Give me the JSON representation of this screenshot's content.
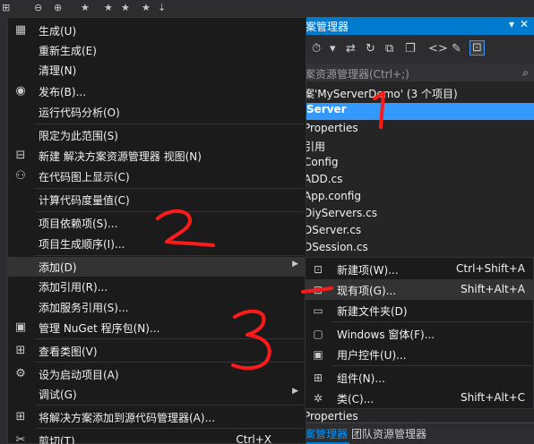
{
  "background": {
    "solution_explorer": {
      "title": "案管理器",
      "search_placeholder": "案资源管理器(Ctrl+;)",
      "tree": [
        "案'MyServerDemo' (3 个项目)",
        "Server",
        "Properties",
        "引用",
        "Config",
        "ADD.cs",
        "App.config",
        "DiyServers.cs",
        "DServer.cs",
        "DSession.cs",
        "Properties"
      ],
      "tabs": [
        "案管理器",
        "团队资源管理器"
      ]
    }
  },
  "context_menu": {
    "items": [
      {
        "label": "生成(U)",
        "icon": "build-icon"
      },
      {
        "label": "重新生成(E)",
        "icon": ""
      },
      {
        "label": "清理(N)",
        "icon": ""
      },
      {
        "label": "发布(B)...",
        "icon": "globe-icon"
      },
      {
        "label": "运行代码分析(O)",
        "icon": ""
      },
      {
        "label": "限定为此范围(S)",
        "icon": ""
      },
      {
        "label": "新建 解决方案资源管理器 视图(N)",
        "icon": "new-view-icon"
      },
      {
        "label": "在代码图上显示(C)",
        "icon": "code-map-icon"
      },
      {
        "label": "计算代码度量值(C)",
        "icon": ""
      },
      {
        "label": "项目依赖项(S)...",
        "icon": ""
      },
      {
        "label": "项目生成顺序(I)...",
        "icon": ""
      },
      {
        "label": "添加(D)",
        "icon": "",
        "has_submenu": true
      },
      {
        "label": "添加引用(R)...",
        "icon": ""
      },
      {
        "label": "添加服务引用(S)...",
        "icon": ""
      },
      {
        "label": "管理 NuGet 程序包(N)...",
        "icon": "nuget-icon"
      },
      {
        "label": "查看类图(V)",
        "icon": "class-diagram-icon"
      },
      {
        "label": "设为启动项目(A)",
        "icon": "gear-icon"
      },
      {
        "label": "调试(G)",
        "icon": "",
        "has_submenu": true
      },
      {
        "label": "将解决方案添加到源代码管理器(A)...",
        "icon": "source-control-icon"
      },
      {
        "label": "剪切(T)",
        "icon": "scissors-icon",
        "shortcut": "Ctrl+X"
      }
    ]
  },
  "submenu": {
    "items": [
      {
        "label": "新建项(W)...",
        "shortcut": "Ctrl+Shift+A",
        "icon": "new-item-icon"
      },
      {
        "label": "现有项(G)...",
        "shortcut": "Shift+Alt+A",
        "icon": "existing-item-icon"
      },
      {
        "label": "新建文件夹(D)",
        "shortcut": "",
        "icon": "new-folder-icon"
      },
      {
        "label": "Windows 窗体(F)...",
        "shortcut": "",
        "icon": "windows-form-icon"
      },
      {
        "label": "用户控件(U)...",
        "shortcut": "",
        "icon": "user-control-icon"
      },
      {
        "label": "组件(N)...",
        "shortcut": "",
        "icon": "component-icon"
      },
      {
        "label": "类(C)...",
        "shortcut": "Shift+Alt+C",
        "icon": "class-icon"
      }
    ]
  },
  "annotations": {
    "marks": [
      "1",
      "2",
      "3"
    ],
    "color": "#ff1a1a"
  },
  "colors": {
    "menu_bg": "#1b1b1c",
    "highlight": "#333334",
    "accent": "#007acc",
    "selection": "#3399ff"
  }
}
